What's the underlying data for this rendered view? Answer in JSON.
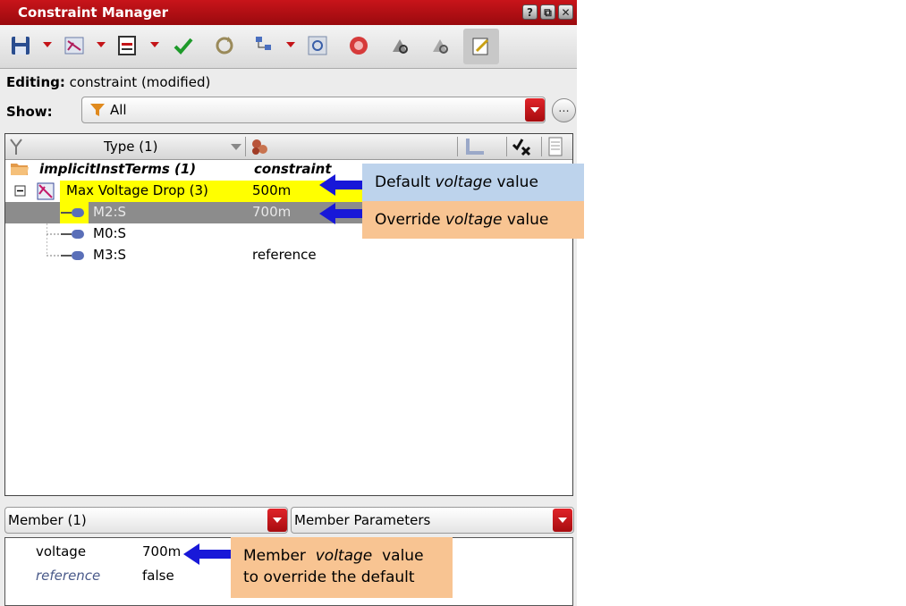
{
  "window": {
    "title": "Constraint Manager",
    "title_buttons": [
      "?",
      "⧉",
      "✕"
    ]
  },
  "toolbar": {
    "icons": [
      "save-icon",
      "constraint-icon",
      "display-icon",
      "check-icon",
      "refresh-icon",
      "hierarchy-icon",
      "target-icon",
      "stop-icon",
      "zoom-in-icon",
      "zoom-out-icon",
      "edit-icon"
    ]
  },
  "editing": {
    "label": "Editing:",
    "value": "constraint (modified)"
  },
  "show": {
    "label": "Show:",
    "value": "All",
    "more": "..."
  },
  "tree": {
    "header_type": "Type (1)",
    "rows": [
      {
        "name": "implicitInstTerms (1)",
        "value": "constraint"
      },
      {
        "name": "Max Voltage Drop (3)",
        "value": "500m"
      },
      {
        "name": "M2:S",
        "value": "700m"
      },
      {
        "name": "M0:S",
        "value": ""
      },
      {
        "name": "M3:S",
        "value": "reference"
      }
    ]
  },
  "callouts": {
    "default": {
      "pre": "Default ",
      "em": "voltage",
      "post": " value"
    },
    "override": {
      "pre": "Override ",
      "em": "voltage",
      "post": " value"
    },
    "member": {
      "line1_pre": "Member ",
      "line1_em": "voltage",
      "line1_post": " value",
      "line2": "to override the default"
    }
  },
  "member": {
    "combo_left": "Member (1)",
    "combo_right": "Member Parameters",
    "params": [
      {
        "name": "voltage",
        "value": "700m"
      },
      {
        "name": "reference",
        "value": "false"
      }
    ]
  },
  "colors": {
    "title_red": "#b0101a",
    "highlight_yellow": "#ffff00",
    "selected_gray": "#8c8c8c",
    "callout_blue": "#bdd3ec",
    "callout_orange": "#f8c492",
    "arrow_blue": "#1818d8"
  }
}
